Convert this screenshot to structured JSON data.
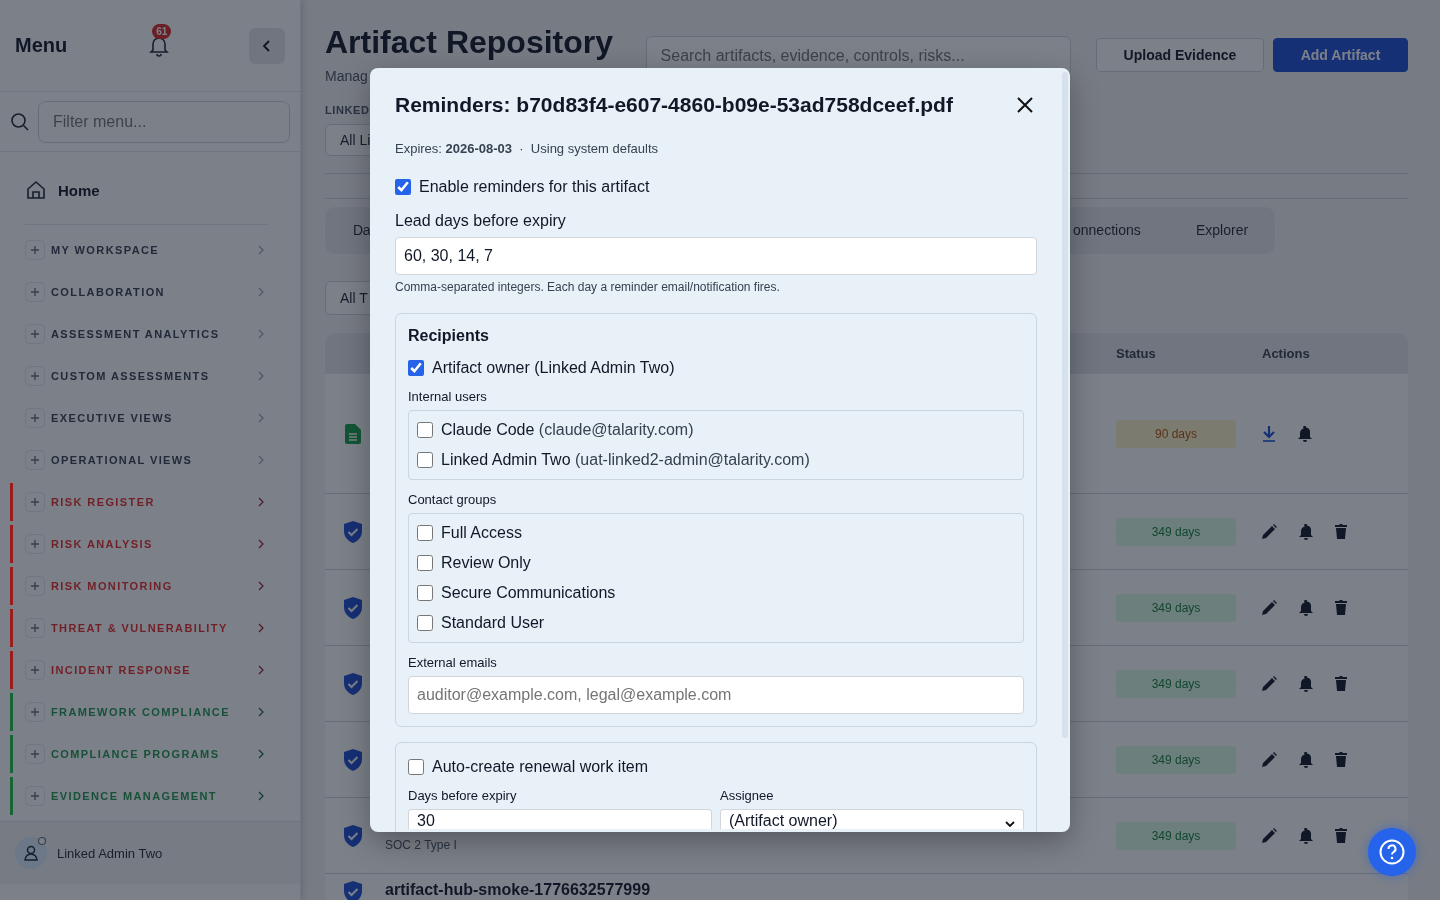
{
  "sidebar": {
    "title": "Menu",
    "notification_count": "61",
    "filter": {
      "placeholder": "Filter menu..."
    },
    "home": "Home",
    "sections": [
      {
        "label": "MY WORKSPACE"
      },
      {
        "label": "COLLABORATION"
      },
      {
        "label": "ASSESSMENT ANALYTICS"
      },
      {
        "label": "CUSTOM ASSESSMENTS"
      },
      {
        "label": "EXECUTIVE VIEWS"
      },
      {
        "label": "OPERATIONAL VIEWS"
      },
      {
        "label": "RISK REGISTER",
        "color": "#9b1c1c"
      },
      {
        "label": "RISK ANALYSIS",
        "color": "#9b1c1c"
      },
      {
        "label": "RISK MONITORING",
        "color": "#9b1c1c"
      },
      {
        "label": "THREAT & VULNERABILITY",
        "color": "#9b1c1c"
      },
      {
        "label": "INCIDENT RESPONSE",
        "color": "#9b1c1c"
      },
      {
        "label": "FRAMEWORK COMPLIANCE",
        "color": "#166534"
      },
      {
        "label": "COMPLIANCE PROGRAMS",
        "color": "#166534"
      },
      {
        "label": "EVIDENCE MANAGEMENT",
        "color": "#166534"
      }
    ],
    "user": "Linked Admin Two"
  },
  "page": {
    "title": "Artifact Repository",
    "subtitle": "Manag",
    "search": {
      "placeholder": "Search artifacts, evidence, controls, risks..."
    },
    "buttons": [
      {
        "label": "Upload Evidence",
        "kind": "secondary"
      },
      {
        "label": "Add Artifact",
        "kind": "primary"
      }
    ],
    "linked_label": "LINKED",
    "linked_filter": "All Li",
    "tabs": [
      {
        "label": "Da",
        "selected": false
      },
      {
        "label": "onnections",
        "selected": false
      },
      {
        "label": "Explorer",
        "selected": false
      }
    ],
    "type_filter": "All T",
    "table": {
      "columns": [
        "Status",
        "Actions"
      ],
      "rows": [
        {
          "kind": "file",
          "status": {
            "label": "90 days",
            "kind": "warning"
          }
        },
        {
          "kind": "control",
          "status": {
            "label": "349 days",
            "kind": "ok"
          }
        },
        {
          "kind": "control",
          "status": {
            "label": "349 days",
            "kind": "ok"
          }
        },
        {
          "kind": "control",
          "status": {
            "label": "349 days",
            "kind": "ok"
          }
        },
        {
          "kind": "control",
          "status": {
            "label": "349 days",
            "kind": "ok"
          }
        },
        {
          "kind": "control",
          "status": {
            "label": "349 days",
            "kind": "ok"
          },
          "detail": "SOC 2 Type I"
        },
        {
          "kind": "control",
          "title": "artifact-hub-smoke-1776632577999"
        }
      ]
    }
  },
  "dialog": {
    "title": "Reminders: b70d83f4-e607-4860-b09e-53ad758dceef.pdf",
    "meta": "Expires: **2026-08-03**  ·  Using system defaults",
    "enable": {
      "label": "Enable reminders for this artifact",
      "checked": true
    },
    "lead_days": {
      "label": "Lead days before expiry",
      "value": "60, 30, 14, 7",
      "hint": "Comma-separated integers. Each day a reminder email/notification fires."
    },
    "recipients": {
      "title": "Recipients",
      "owner": {
        "label": "Artifact owner (Linked Admin Two)",
        "checked": true
      },
      "internal_users_label": "Internal users",
      "internal_users": [
        {
          "name": "Claude Code",
          "email": "(claude@talarity.com)",
          "checked": false
        },
        {
          "name": "Linked Admin Two",
          "email": "(uat-linked2-admin@talarity.com)",
          "checked": false
        }
      ],
      "contact_groups_label": "Contact groups",
      "contact_groups": [
        {
          "label": "Full Access",
          "checked": false
        },
        {
          "label": "Review Only",
          "checked": false
        },
        {
          "label": "Secure Communications",
          "checked": false
        },
        {
          "label": "Standard User",
          "checked": false
        }
      ],
      "external_emails": {
        "label": "External emails",
        "placeholder": "auditor@example.com, legal@example.com"
      }
    },
    "renewal": {
      "label": "Auto-create renewal work item",
      "checked": false,
      "days_label": "Days before expiry",
      "days_value": "30",
      "assignee_label": "Assignee",
      "assignee_value": "(Artifact owner)"
    }
  }
}
